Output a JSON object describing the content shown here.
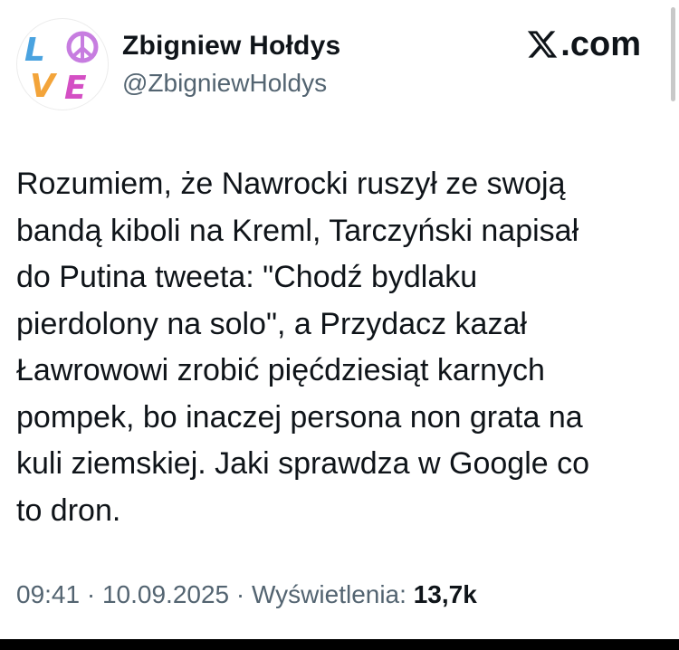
{
  "header": {
    "display_name": "Zbigniew Hołdys",
    "handle": "@ZbigniewHoldys",
    "source_label": ".com"
  },
  "avatar": {
    "letters": [
      "L",
      "V",
      "E"
    ],
    "symbol": "peace-sign",
    "colors": {
      "L": "#4aa3e0",
      "peace": "#c77de0",
      "V": "#f3a43a",
      "E": "#d44fc4"
    }
  },
  "tweet": {
    "text": "Rozumiem, że Nawrocki ruszył ze swoją\nbandą kiboli na Kreml, Tarczyński napisał\ndo Putina tweeta: \"Chodź bydlaku\npierdolony na solo\", a Przydacz kazał\nŁawrowowi zrobić pięćdziesiąt karnych\npompek, bo inaczej persona non grata na\nkuli ziemskiej. Jaki sprawdza w Google co\nto dron."
  },
  "meta": {
    "time": "09:41",
    "sep1": " · ",
    "date": "10.09.2025",
    "sep2": " · ",
    "views_label": "Wyświetlenia: ",
    "views_count": "13,7k"
  },
  "colors": {
    "text_primary": "#0f1419",
    "text_secondary": "#536471"
  }
}
